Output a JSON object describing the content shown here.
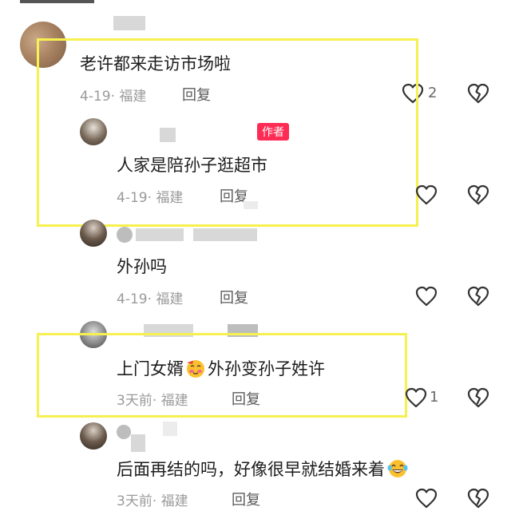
{
  "comments": [
    {
      "text": "老许都来走访市场啦",
      "date": "4-19",
      "location": "福建",
      "reply": "回复",
      "likes": "2"
    },
    {
      "text": "人家是陪孙子逛超市",
      "date": "4-19",
      "location": "福建",
      "reply": "回复",
      "badge": "作者"
    },
    {
      "text": "外孙吗",
      "date": "4-19",
      "location": "福建",
      "reply": "回复"
    },
    {
      "text": "上门女婿",
      "text_after": "外孙变孙子姓许",
      "date": "3天前",
      "location": "福建",
      "reply": "回复",
      "likes": "1"
    },
    {
      "text": "后面再结的吗，好像很早就结婚来着",
      "date": "3天前",
      "location": "福建",
      "reply": "回复"
    }
  ],
  "icons": {
    "like": "heart-icon",
    "dislike": "broken-heart-icon",
    "emoji_blush": "blushing-face-emoji",
    "emoji_laugh": "tears-of-joy-emoji"
  },
  "colors": {
    "highlight": "#f6f050",
    "badge": "#fe2c55"
  }
}
